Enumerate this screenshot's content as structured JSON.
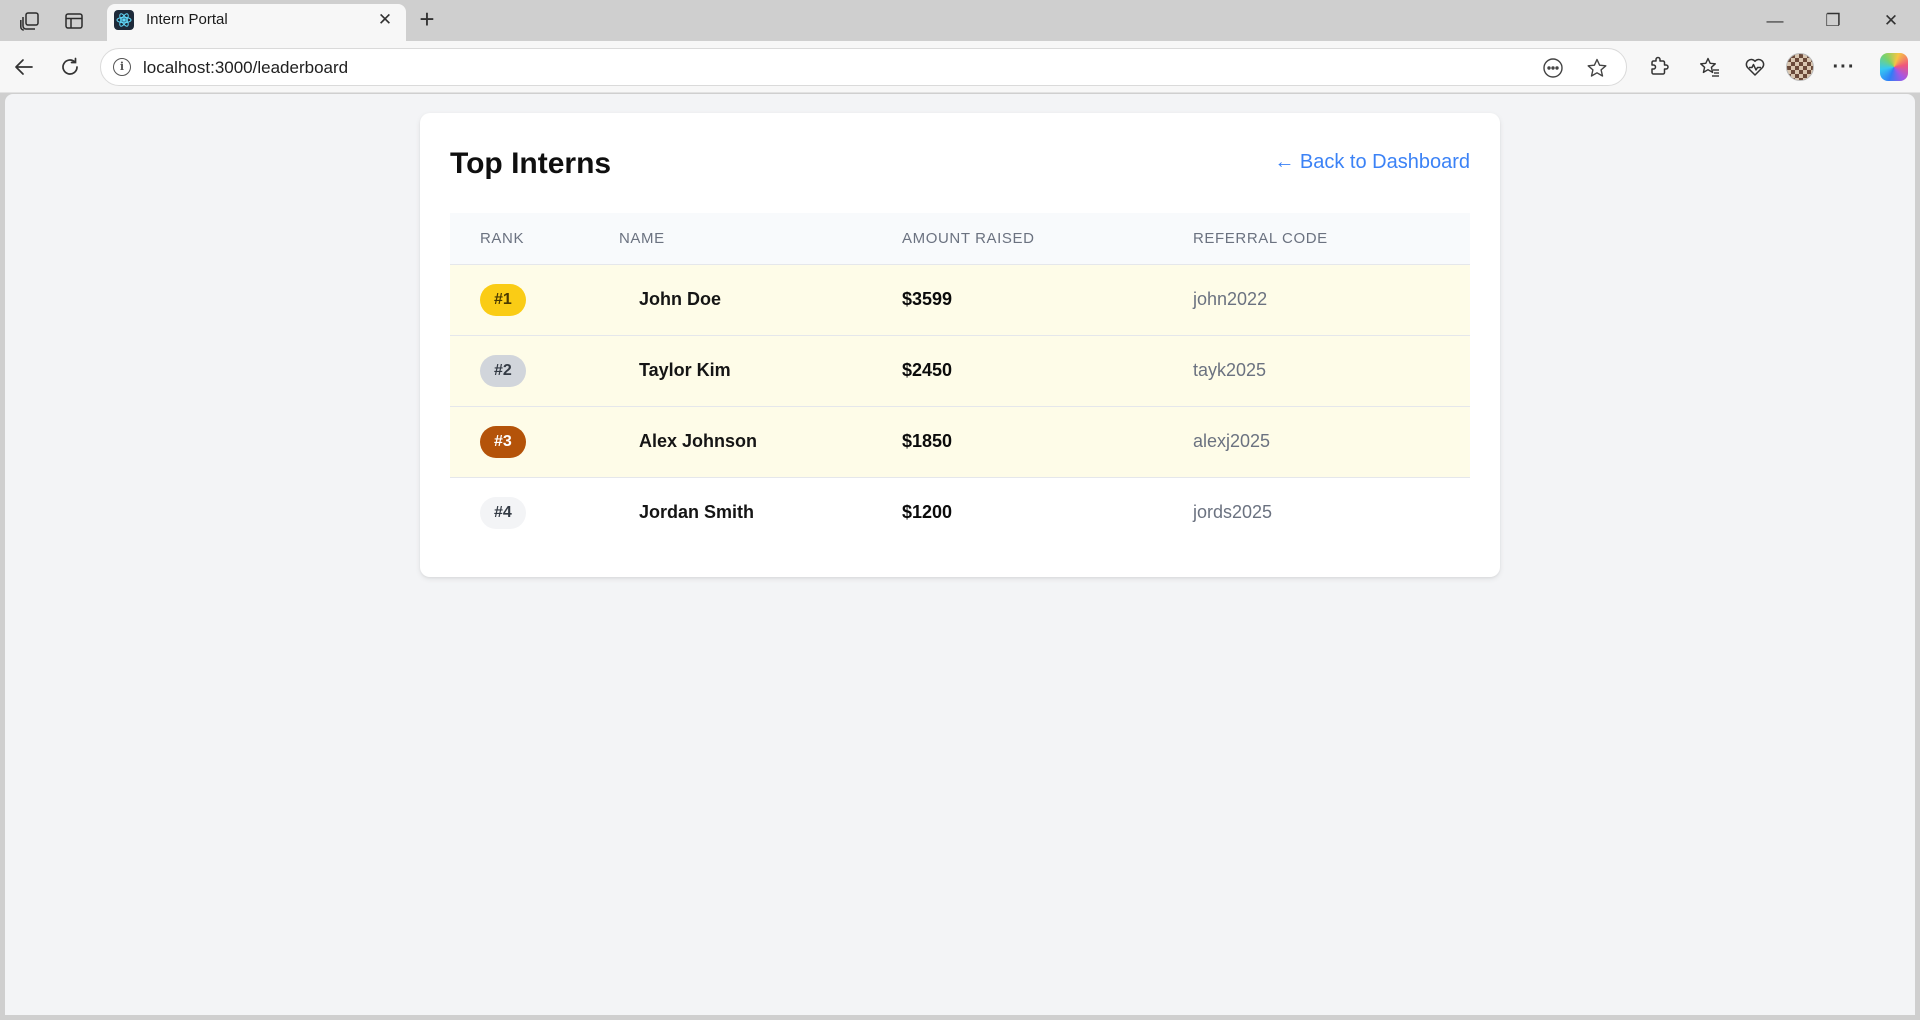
{
  "browser": {
    "tab_title": "Intern Portal",
    "tab_close": "✕",
    "new_tab": "+",
    "url": "localhost:3000/leaderboard",
    "window_controls": {
      "minimize": "—",
      "restore": "❐",
      "close": "✕"
    },
    "icons": [
      "workspaces-icon",
      "vertical-tabs-icon",
      "react-favicon-icon",
      "back-icon",
      "refresh-icon",
      "info-icon",
      "reading-mode-icon",
      "favorite-star-icon",
      "extensions-icon",
      "favorites-icon",
      "browser-essentials-icon",
      "profile-avatar",
      "more-icon",
      "copilot-icon"
    ],
    "more_label": "···"
  },
  "page": {
    "title": "Top Interns",
    "back_link": "← Back to Dashboard",
    "table": {
      "headers": {
        "rank": "Rank",
        "name": "Name",
        "amount": "Amount Raised",
        "code": "Referral Code"
      },
      "rows": [
        {
          "rank": "#1",
          "name": "John Doe",
          "amount": "$3599",
          "code": "john2022"
        },
        {
          "rank": "#2",
          "name": "Taylor Kim",
          "amount": "$2450",
          "code": "tayk2025"
        },
        {
          "rank": "#3",
          "name": "Alex Johnson",
          "amount": "$1850",
          "code": "alexj2025"
        },
        {
          "rank": "#4",
          "name": "Jordan Smith",
          "amount": "$1200",
          "code": "jords2025"
        }
      ]
    },
    "colors": {
      "accent_link": "#3b82f6",
      "gold": "#facc15",
      "silver": "#d1d5db",
      "bronze": "#b45309",
      "top_row_bg": "#fefce8"
    }
  }
}
